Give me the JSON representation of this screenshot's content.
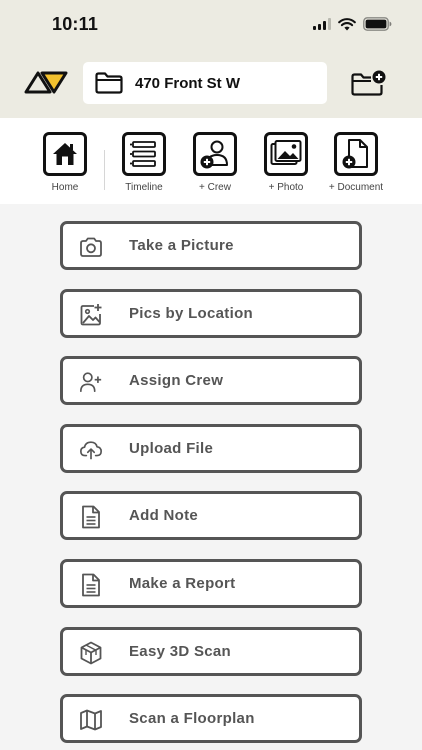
{
  "status_bar": {
    "time": "10:11"
  },
  "header": {
    "project_name": "470 Front St W"
  },
  "quick_actions": [
    {
      "label": "Home",
      "icon": "home-icon"
    },
    {
      "label": "Timeline",
      "icon": "timeline-icon"
    },
    {
      "label": "+ Crew",
      "icon": "add-crew-icon"
    },
    {
      "label": "+ Photo",
      "icon": "add-photo-icon"
    },
    {
      "label": "+ Document",
      "icon": "add-document-icon"
    }
  ],
  "actions": [
    {
      "label": "Take a Picture",
      "icon": "camera-icon"
    },
    {
      "label": "Pics by Location",
      "icon": "photo-location-icon"
    },
    {
      "label": "Assign Crew",
      "icon": "user-add-icon"
    },
    {
      "label": "Upload File",
      "icon": "cloud-upload-icon"
    },
    {
      "label": "Add Note",
      "icon": "note-icon"
    },
    {
      "label": "Make a Report",
      "icon": "report-icon"
    },
    {
      "label": "Easy 3D Scan",
      "icon": "cube-icon"
    },
    {
      "label": "Scan a Floorplan",
      "icon": "map-icon"
    }
  ],
  "colors": {
    "header_bg": "#ecebe2",
    "logo_accent": "#f2c12e",
    "button_border": "#555555"
  }
}
